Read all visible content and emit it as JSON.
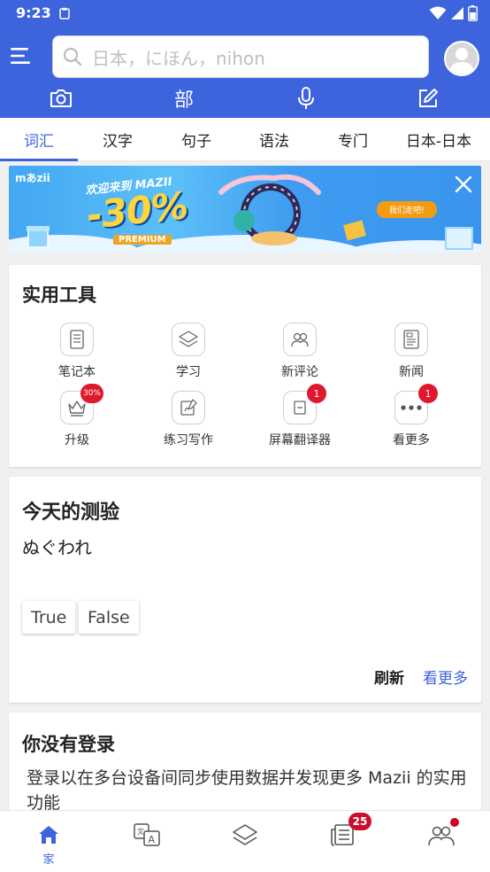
{
  "status_bar": {
    "time": "9:23"
  },
  "search": {
    "placeholder": "日本，にほん，nihon"
  },
  "header_tools": {
    "kanji_label": "部"
  },
  "tabs": [
    {
      "label": "词汇",
      "active": true
    },
    {
      "label": "汉字",
      "active": false
    },
    {
      "label": "句子",
      "active": false
    },
    {
      "label": "语法",
      "active": false
    },
    {
      "label": "专门",
      "active": false
    },
    {
      "label": "日本-日本",
      "active": false
    }
  ],
  "banner": {
    "logo": "mあzii",
    "welcome": "欢迎来到 MAZII",
    "discount": "-30%",
    "premium": "PREMIUM",
    "cta": "我们走吧!"
  },
  "tools_card": {
    "title": "实用工具",
    "items": [
      {
        "label": "笔记本",
        "icon": "notebook-icon"
      },
      {
        "label": "学习",
        "icon": "layers-icon"
      },
      {
        "label": "新评论",
        "icon": "community-icon"
      },
      {
        "label": "新闻",
        "icon": "news-icon"
      },
      {
        "label": "升级",
        "icon": "crown-icon",
        "badge": "30%"
      },
      {
        "label": "练习写作",
        "icon": "writing-icon"
      },
      {
        "label": "屏幕翻译器",
        "icon": "screen-translate-icon",
        "badge": "1"
      },
      {
        "label": "看更多",
        "icon": "more-dots-icon",
        "badge": "1"
      }
    ]
  },
  "quiz_card": {
    "title": "今天的测验",
    "word": "ぬぐわれ",
    "answers": [
      "True",
      "False"
    ],
    "refresh": "刷新",
    "more": "看更多"
  },
  "login_card": {
    "title": "你没有登录",
    "description": "登录以在多台设备间同步使用数据并发现更多 Mazii 的实用功能"
  },
  "bottom_nav": {
    "home_label": "家",
    "news_badge": "25"
  },
  "colors": {
    "primary": "#3d63dd",
    "badge_red": "#e0182d",
    "banner_yellow": "#ffd53a"
  }
}
